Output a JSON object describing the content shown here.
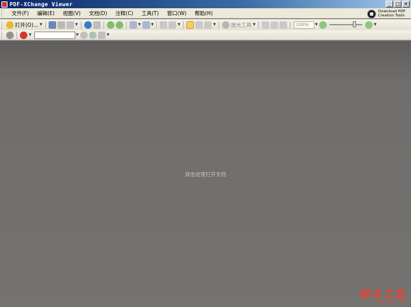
{
  "window": {
    "title": "PDF-XChange Viewer"
  },
  "menu": [
    "文件(F)",
    "编辑(E)",
    "视图(V)",
    "文档(D)",
    "注释(C)",
    "工具(T)",
    "窗口(W)",
    "帮助(H)"
  ],
  "promo": {
    "line1": "Download PDF",
    "line2": "Creation Tools"
  },
  "toolbar": {
    "open_label": "打开(O)...",
    "zoom_tool_label": "放大工具",
    "zoom_value": "100%"
  },
  "document": {
    "placeholder": "双击这里打开文档"
  },
  "watermark": {
    "main": "脚本之家",
    "sub": "www.jb51.net"
  },
  "colors": {
    "title_bar": "#0a246a",
    "doc_background": "#706e6c",
    "watermark": "#e0463e"
  }
}
